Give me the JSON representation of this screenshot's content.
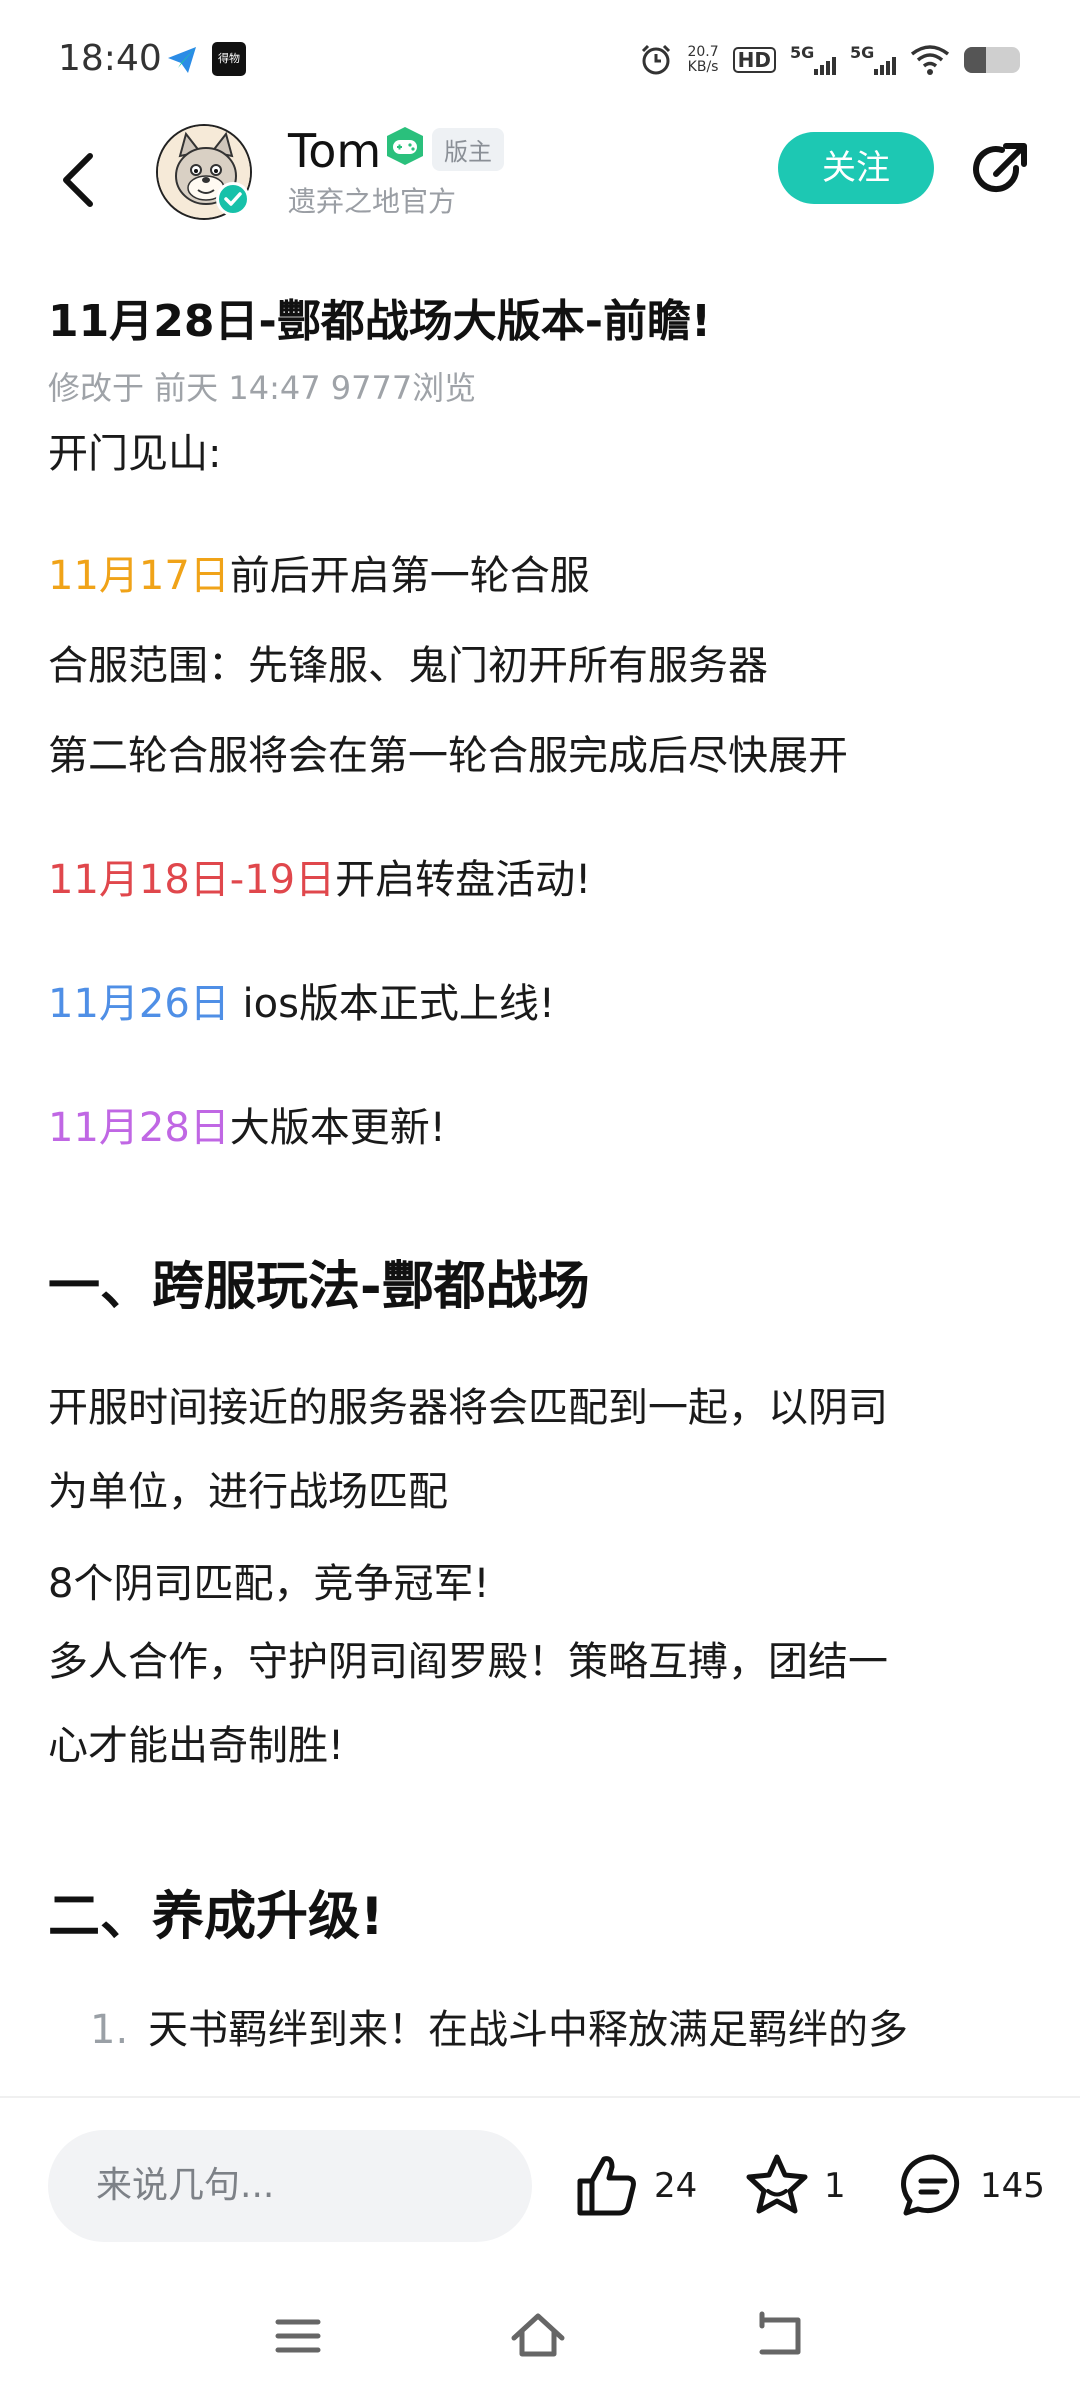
{
  "status_bar": {
    "time": "18:40",
    "app2_text": "得物",
    "net_speed_value": "20.7",
    "net_speed_unit": "KB/s",
    "hd_label": "HD",
    "sim1_label": "5G",
    "sim2_label": "5G",
    "battery_level": 0.4
  },
  "header": {
    "author_name": "Tom",
    "moderator_tag": "版主",
    "author_subtitle": "遗弃之地官方",
    "follow_label": "关注"
  },
  "post": {
    "title": "11月28日-酆都战场大版本-前瞻!",
    "meta": "修改于 前天 14:47   9777浏览",
    "intro": "开门见山:",
    "line1_date": "11月17日",
    "line1_text": "前后开启第一轮合服",
    "line2": "合服范围：先锋服、鬼门初开所有服务器",
    "line3": "第二轮合服将会在第一轮合服完成后尽快展开",
    "line4_date": "11月18日-19日",
    "line4_text": "开启转盘活动!",
    "line5_date": "11月26日",
    "line5_text": " ios版本正式上线!",
    "line6_date": "11月28日",
    "line6_text": "大版本更新!",
    "section1_title": "一、跨服玩法-酆都战场",
    "section1_p1a": "开服时间接近的服务器将会匹配到一起，以阴司",
    "section1_p1b": "为单位，进行战场匹配",
    "section1_p2": "8个阴司匹配，竞争冠军!",
    "section1_p3a": "多人合作，守护阴司阎罗殿！策略互搏，团结一",
    "section1_p3b": "心才能出奇制胜!",
    "section2_title": "二、养成升级!",
    "list_item1_num": "1.",
    "list_item1_text": "天书羁绊到来！在战斗中释放满足羁绊的多"
  },
  "bottom_bar": {
    "comment_placeholder": "来说几句...",
    "likes": "24",
    "favorites": "1",
    "comments": "145"
  },
  "colors": {
    "accent": "#1dc8b3",
    "orange": "#f0a318",
    "red": "#e0474c",
    "blue": "#4f8fe6",
    "purple": "#c067e4"
  }
}
